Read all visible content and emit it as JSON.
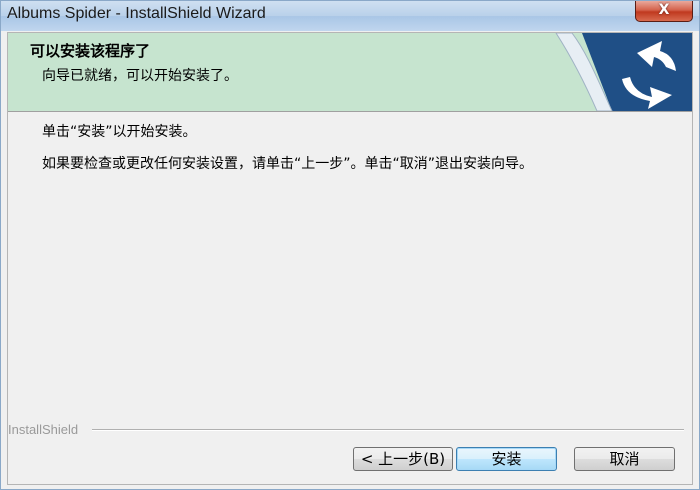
{
  "window": {
    "title": "Albums Spider - InstallShield Wizard",
    "close_glyph": "X"
  },
  "header": {
    "title": "可以安装该程序了",
    "subtitle": "向导已就绪，可以开始安装了。",
    "logo_icon": "installshield-logo-icon"
  },
  "body": {
    "line1": "单击“安装”以开始安装。",
    "line2": "如果要检查或更改任何安装设置，请单击“上一步”。单击“取消”退出安装向导。"
  },
  "footer": {
    "brand": "InstallShield"
  },
  "buttons": {
    "back": "< 上一步(B)",
    "install": "安装",
    "cancel": "取消"
  },
  "colors": {
    "header_bg": "#c6e4cf",
    "logo_blue": "#1f4f86"
  }
}
